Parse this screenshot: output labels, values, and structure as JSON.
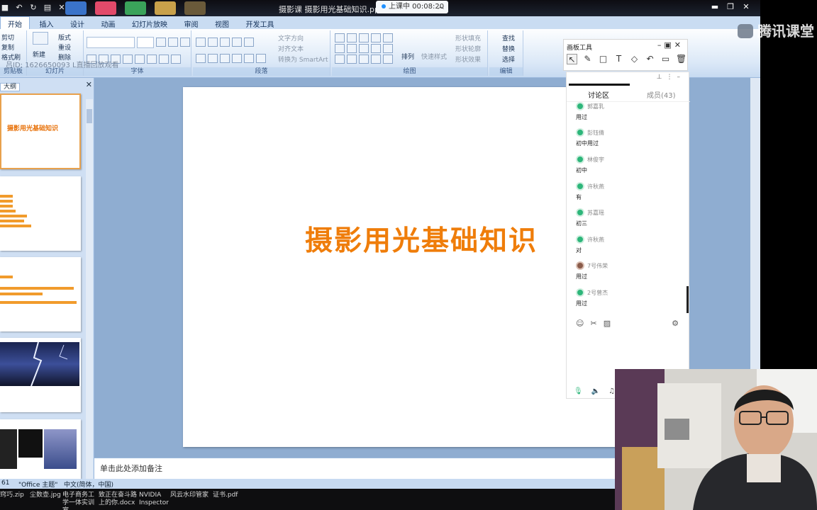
{
  "window": {
    "title": "摄影课 摄影用光基础知识.ppt [兼容模式]",
    "class_status": "上课中 00:08:20"
  },
  "ribbon": {
    "tabs": [
      "开始",
      "插入",
      "设计",
      "动画",
      "幻灯片放映",
      "审阅",
      "视图",
      "开发工具"
    ],
    "clipboard": {
      "cut": "剪切",
      "copy": "复制",
      "format_painter": "格式刷",
      "group": "剪贴板"
    },
    "slides": {
      "new_slide": "新建",
      "layout": "版式",
      "reset": "重设",
      "delete": "删除",
      "group": "幻灯片"
    },
    "font": {
      "group": "字体"
    },
    "paragraph": {
      "text_direction": "文字方向",
      "align_text": "对齐文本",
      "convert_smartart": "转换为 SmartArt",
      "group": "段落"
    },
    "drawing": {
      "arrange": "排列",
      "quick_styles": "快速样式",
      "shape_fill": "形状填充",
      "shape_outline": "形状轮廓",
      "shape_effects": "形状效果",
      "group": "绘图"
    },
    "editing": {
      "find": "查找",
      "replace": "替换",
      "select": "选择",
      "group": "编辑"
    },
    "overlay_id": "吕ID: 1626650093 L直播回放观看"
  },
  "slides_pane": {
    "tab_label": "大纲",
    "thumb1_title": "摄影用光基础知识"
  },
  "slide": {
    "title": "摄影用光基础知识",
    "notes_placeholder": "单击此处添加备注"
  },
  "status": {
    "slide_count": "61",
    "theme": "\"Office 主题\"",
    "language": "中文(简体，中国)"
  },
  "files": [
    "窍巧.zip",
    "尘数壶.jpg",
    "电子商务工学一体实训室...",
    "致正在奋斗路上的你.docx",
    "NVIDIA Inspector",
    "风云水印管家",
    "证书.pdf"
  ],
  "logo": "腾讯课堂",
  "board_tools": {
    "title": "画板工具",
    "tools": [
      "pointer-icon",
      "pen-icon",
      "rectangle-icon",
      "text-icon",
      "eraser-icon",
      "undo-icon",
      "screen-icon",
      "trash-icon"
    ]
  },
  "chat": {
    "tab_discussion": "讨论区",
    "tab_members": "成员(43)",
    "messages": [
      {
        "name": "郭嘉乳",
        "text": "用过"
      },
      {
        "name": "彭钰倩",
        "text": "初中用过"
      },
      {
        "name": "林俊宇",
        "text": "初中"
      },
      {
        "name": "许秋燕",
        "text": "有"
      },
      {
        "name": "苏嘉瑶",
        "text": "初三"
      },
      {
        "name": "许秋燕",
        "text": "对"
      },
      {
        "name": "7号伟荣",
        "text": "用过"
      },
      {
        "name": "2号曾杰",
        "text": "用过"
      }
    ]
  },
  "colors": {
    "accent_orange": "#ef7d0a",
    "ribbon_blue": "#c9dcf2",
    "canvas_blue": "#8fadd1",
    "online_green": "#2db67a"
  }
}
